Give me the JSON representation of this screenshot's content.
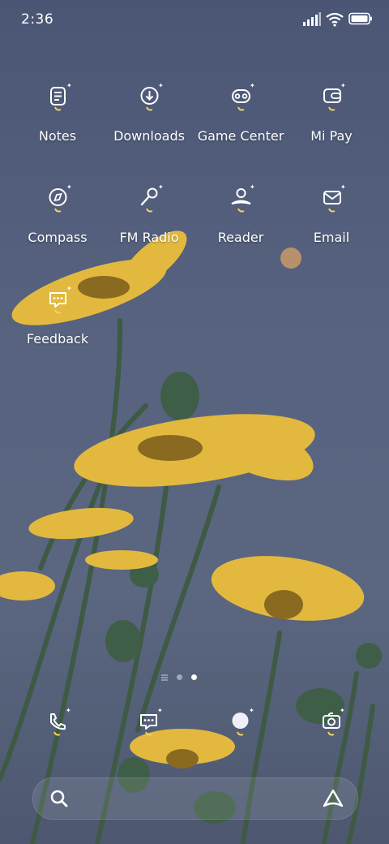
{
  "status_bar": {
    "time": "2:36",
    "icons": [
      "signal-icon",
      "wifi-icon",
      "battery-icon"
    ]
  },
  "apps": [
    {
      "label": "Notes",
      "icon": "notes-icon"
    },
    {
      "label": "Downloads",
      "icon": "download-icon"
    },
    {
      "label": "Game Center",
      "icon": "gamepad-icon"
    },
    {
      "label": "Mi Pay",
      "icon": "wallet-icon"
    },
    {
      "label": "Compass",
      "icon": "compass-icon"
    },
    {
      "label": "FM Radio",
      "icon": "microphone-icon"
    },
    {
      "label": "Reader",
      "icon": "reader-icon"
    },
    {
      "label": "Email",
      "icon": "envelope-icon"
    },
    {
      "label": "Feedback",
      "icon": "chat-bubble-icon"
    }
  ],
  "page_indicator": {
    "pages": 2,
    "current_page": 2
  },
  "dock": [
    {
      "icon": "phone-icon"
    },
    {
      "icon": "message-icon"
    },
    {
      "icon": "browser-icon"
    },
    {
      "icon": "camera-icon"
    }
  ],
  "search_bar": {
    "icon": "search-icon",
    "assistant_icon": "assistant-icon"
  },
  "colors": {
    "background": "#56627f",
    "flower": "#e0b63a",
    "stem": "#3d5a45",
    "icon_accent": "#f2d25a"
  }
}
